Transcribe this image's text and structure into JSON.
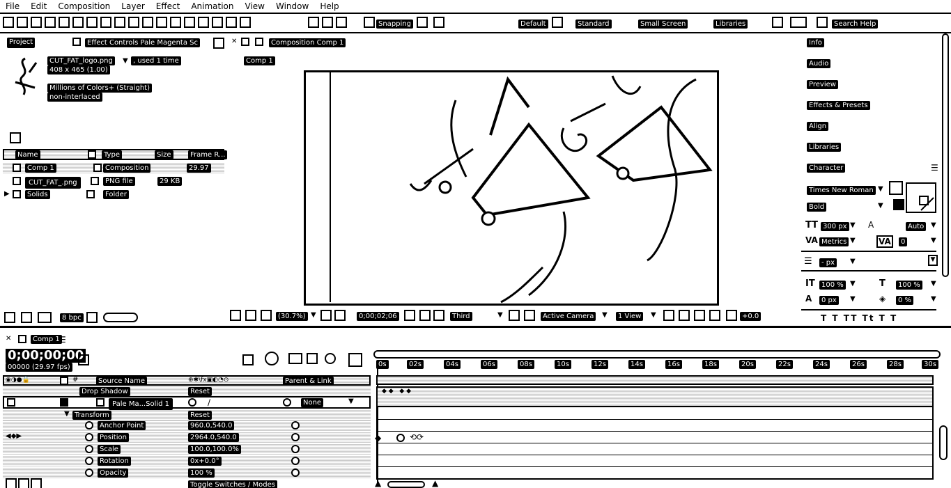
{
  "menu": [
    "File",
    "Edit",
    "Composition",
    "Layer",
    "Effect",
    "Animation",
    "View",
    "Window",
    "Help"
  ],
  "toolbar": {
    "snapping": "Snapping",
    "workspaces": [
      "Default",
      "Standard",
      "Small Screen",
      "Libraries"
    ],
    "search_help": "Search Help"
  },
  "project": {
    "tab": "Project",
    "effect_controls_tab": "Effect Controls Pale Magenta Sc",
    "item_name": "CUT_FAT_logo.png",
    "used": ", used 1 time",
    "dimensions": "408 x 465 (1.00)",
    "colors": "Millions of Colors+ (Straight)",
    "interlace": "non-interlaced",
    "columns": [
      "Name",
      "Type",
      "Size",
      "Frame R..."
    ],
    "rows": [
      {
        "name": "Comp 1",
        "type": "Composition",
        "size": "",
        "rate": "29.97"
      },
      {
        "name": "CUT_FAT_.png",
        "type": "PNG file",
        "size": "29 KB",
        "rate": ""
      },
      {
        "name": "Solids",
        "type": "Folder",
        "size": "",
        "rate": ""
      }
    ],
    "bpc": "8 bpc"
  },
  "composition": {
    "tab": "Composition Comp 1",
    "sub_tab": "Comp 1",
    "zoom": "(30.7%)",
    "timecode": "0;00;02;06",
    "resolution": "Third",
    "camera": "Active Camera",
    "view": "1 View",
    "exposure": "+0.0"
  },
  "right_panels": [
    "Info",
    "Audio",
    "Preview",
    "Effects & Presets",
    "Align",
    "Libraries",
    "Character"
  ],
  "character": {
    "font": "Times New Roman",
    "style": "Bold",
    "size": "300 px",
    "leading": "Auto",
    "kerning": "Metrics",
    "tracking": "0",
    "stroke": "- px",
    "vscale": "100 %",
    "hscale": "100 %",
    "baseline": "0 px",
    "tsume": "0 %"
  },
  "timeline": {
    "tab": "Comp 1",
    "timecode": "0;00;00;00",
    "frames": "00000 (29.97 fps)",
    "cols": {
      "source": "Source Name",
      "parent": "Parent & Link"
    },
    "drop_shadow": "Drop Shadow",
    "reset": "Reset",
    "layer_name": "Pale Ma...Solid 1",
    "none": "None",
    "transform": "Transform",
    "props": [
      {
        "name": "Anchor Point",
        "value": "960.0,540.0"
      },
      {
        "name": "Position",
        "value": "2964.0,540.0"
      },
      {
        "name": "Scale",
        "value": "100.0,100.0%"
      },
      {
        "name": "Rotation",
        "value": "0x+0.0°"
      },
      {
        "name": "Opacity",
        "value": "100 %"
      }
    ],
    "ticks": [
      "0s",
      "02s",
      "04s",
      "06s",
      "08s",
      "10s",
      "12s",
      "14s",
      "16s",
      "18s",
      "20s",
      "22s",
      "24s",
      "26s",
      "28s",
      "30s"
    ],
    "toggle": "Toggle Switches / Modes"
  }
}
